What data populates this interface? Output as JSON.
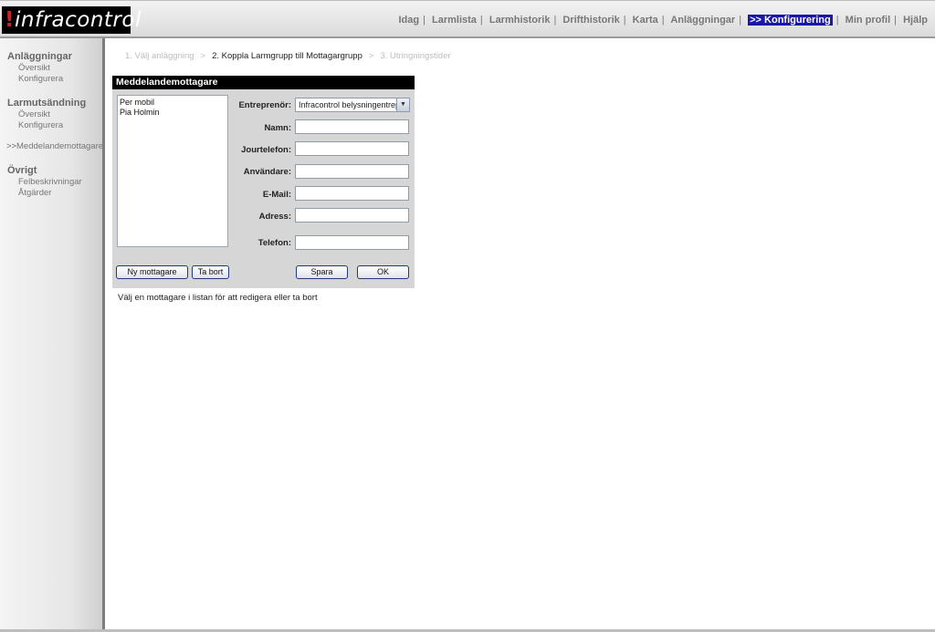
{
  "header": {
    "logo_text": "infracontrol",
    "nav": [
      {
        "label": "Idag",
        "active": false
      },
      {
        "label": "Larmlista",
        "active": false
      },
      {
        "label": "Larmhistorik",
        "active": false
      },
      {
        "label": "Drifthistorik",
        "active": false
      },
      {
        "label": "Karta",
        "active": false
      },
      {
        "label": "Anläggningar",
        "active": false
      },
      {
        "label": ">> Konfigurering",
        "active": true
      },
      {
        "label": "Min profil",
        "active": false
      },
      {
        "label": "Hjälp",
        "active": false
      }
    ],
    "separator": "|",
    "active_color": "#1a16a8"
  },
  "sidebar": {
    "sections": [
      {
        "title": "Anläggningar",
        "items": [
          "Översikt",
          "Konfigurera"
        ]
      },
      {
        "title": "Larmutsändning",
        "items": [
          "Översikt",
          "Konfigurera"
        ]
      },
      {
        "title": "Övrigt",
        "items": [
          "Felbeskrivningar",
          "Åtgärder"
        ]
      }
    ],
    "active_item": {
      "arrow": ">>",
      "label": "Meddelandemottagare"
    }
  },
  "steps": {
    "step1": "1. Välj anläggning",
    "step2": "2. Koppla Larmgrupp till Mottagargrupp",
    "step3": "3. Utringningstider",
    "separator": ">"
  },
  "panel": {
    "title": "Meddelandemottagare",
    "recipients": [
      "Per mobil",
      "Pia Holmin"
    ],
    "fields": {
      "entreprenor": {
        "label": "Entreprenör:",
        "value": "Infracontrol belysningentreprenör"
      },
      "namn": {
        "label": "Namn:",
        "value": ""
      },
      "jourtelefon": {
        "label": "Jourtelefon:",
        "value": ""
      },
      "anvandare": {
        "label": "Användare:",
        "value": ""
      },
      "email": {
        "label": "E-Mail:",
        "value": ""
      },
      "adress": {
        "label": "Adress:",
        "value": ""
      },
      "telefon": {
        "label": "Telefon:",
        "value": ""
      }
    },
    "buttons": {
      "new": "Ny mottagare",
      "delete": "Ta bort",
      "save": "Spara",
      "ok": "OK"
    }
  },
  "hint": "Välj en mottagare i listan för att redigera eller ta bort"
}
